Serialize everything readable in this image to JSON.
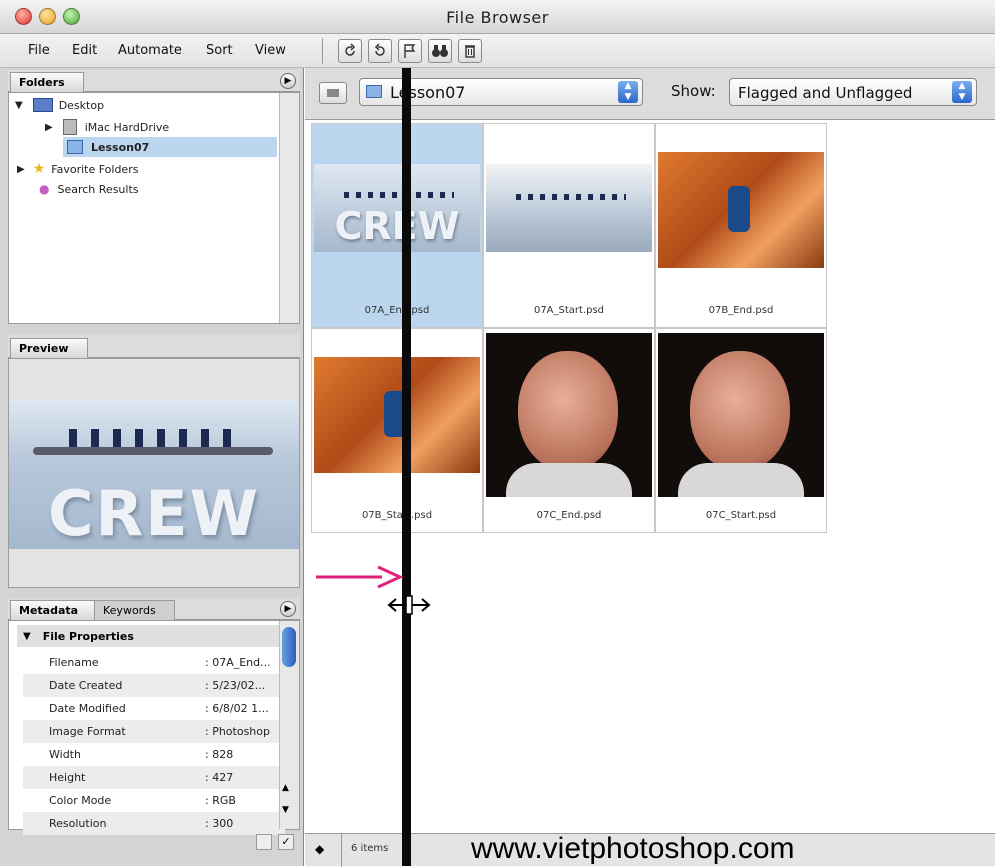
{
  "window": {
    "title": "File Browser"
  },
  "menu": [
    "File",
    "Edit",
    "Automate",
    "Sort",
    "View"
  ],
  "folders_tab": "Folders",
  "tree": {
    "desktop": "Desktop",
    "imac": "iMac HardDrive",
    "lesson": "Lesson07",
    "favorites": "Favorite Folders",
    "search": "Search Results"
  },
  "preview_tab": "Preview",
  "preview_text": "CREW",
  "metadata_tabs": {
    "metadata": "Metadata",
    "keywords": "Keywords"
  },
  "file_properties": "File Properties",
  "metadata_rows": [
    {
      "label": "Filename",
      "value": ": 07A_End..."
    },
    {
      "label": "Date Created",
      "value": ": 5/23/02..."
    },
    {
      "label": "Date Modified",
      "value": ": 6/8/02 1..."
    },
    {
      "label": "Image Format",
      "value": ": Photoshop"
    },
    {
      "label": "Width",
      "value": ": 828"
    },
    {
      "label": "Height",
      "value": ": 427"
    },
    {
      "label": "Color Mode",
      "value": ": RGB"
    },
    {
      "label": "Resolution",
      "value": ": 300"
    }
  ],
  "location": {
    "folder": "Lesson07",
    "show_label": "Show:",
    "show_value": "Flagged and Unflagged"
  },
  "thumbs": [
    {
      "name": "07A_End.psd",
      "type": "crew",
      "selected": true
    },
    {
      "name": "07A_Start.psd",
      "type": "rowers",
      "selected": false
    },
    {
      "name": "07B_End.psd",
      "type": "climb",
      "selected": false
    },
    {
      "name": "07B_Start.psd",
      "type": "climb",
      "selected": false
    },
    {
      "name": "07C_End.psd",
      "type": "portrait",
      "selected": false
    },
    {
      "name": "07C_Start.psd",
      "type": "portrait",
      "selected": false
    }
  ],
  "status": {
    "count": "6 items"
  },
  "watermark": "www.vietphotoshop.com",
  "colors": {
    "selected": "#bcd6ef",
    "arrow": "#e0207a"
  }
}
